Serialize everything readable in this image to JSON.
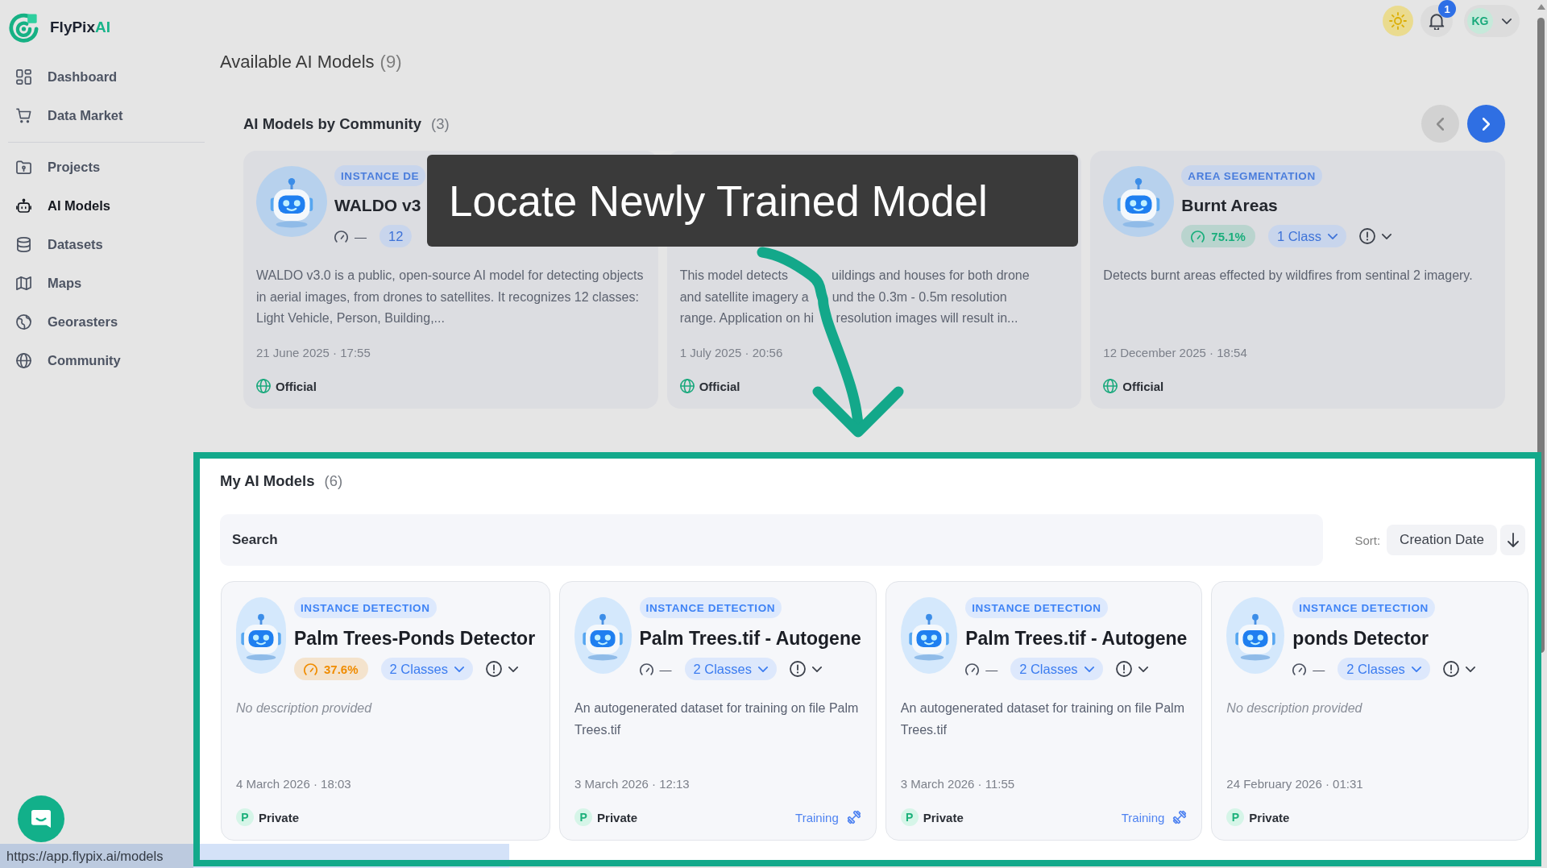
{
  "sidebar": {
    "brand": {
      "name": "FlyPix",
      "accent": "AI"
    },
    "sections": [
      {
        "items": [
          {
            "label": "Dashboard",
            "selected": false
          },
          {
            "label": "Data Market",
            "selected": false
          }
        ]
      },
      {
        "items": [
          {
            "label": "Projects",
            "selected": false
          },
          {
            "label": "AI Models",
            "selected": true
          },
          {
            "label": "Datasets",
            "selected": false
          },
          {
            "label": "Maps",
            "selected": false
          },
          {
            "label": "Georasters",
            "selected": false
          },
          {
            "label": "Community",
            "selected": false
          }
        ]
      }
    ]
  },
  "topbar": {
    "dark_mode": false,
    "notifications": {
      "count": "1"
    },
    "user": {
      "initials": "KG"
    }
  },
  "page": {
    "title": "Available AI Models",
    "count": "(9)"
  },
  "community": {
    "title": "AI Models by Community",
    "count": "(3)",
    "carousel": {
      "prev_enabled": false,
      "next_enabled": true
    },
    "cards": [
      {
        "avatar": true,
        "type": "INSTANCE DE",
        "name": "WALDO v3",
        "accuracy": {
          "text": "—"
        },
        "classes": {
          "text": "12",
          "caret": false
        },
        "info_button": false,
        "description": "WALDO v3.0 is a public, open-source AI model for detecting objects in aerial images, from drones to satellites. It recognizes 12 classes: Light Vehicle, Person, Building,...",
        "description_missing": false,
        "date": "21 June 2025 · 17:55",
        "visibility": {
          "kind": "official",
          "label": "Official"
        }
      },
      {
        "avatar": false,
        "info_button": false,
        "description_lines": [
          [
            "This model detects",
            "uildings and houses for both drone"
          ],
          [
            "and satellite imagery a",
            "und the 0.3m - 0.5m resolution"
          ],
          [
            "range. Application on hi",
            "resolution images will result in..."
          ]
        ],
        "description_missing": false,
        "date": "1 July 2025 · 20:56",
        "visibility": {
          "kind": "official",
          "label": "Official"
        }
      },
      {
        "avatar": true,
        "type": "AREA SEGMENTATION",
        "name": "Burnt Areas",
        "accuracy": {
          "text": "75.1%",
          "color": "#1aae7c"
        },
        "classes": {
          "text": "1 Class",
          "caret": true
        },
        "info_button": true,
        "description": "Detects burnt areas effected by wildfires from sentinal 2 imagery.",
        "description_missing": false,
        "date": "12 December 2025 · 18:54",
        "visibility": {
          "kind": "official",
          "label": "Official"
        }
      }
    ]
  },
  "annotation": {
    "callout": "Locate Newly Trained Model"
  },
  "my_models": {
    "title": "My AI Models",
    "count": "(6)",
    "search": {
      "placeholder": "Search"
    },
    "sort": {
      "label": "Sort:",
      "value": "Creation Date",
      "descending": true
    },
    "cards": [
      {
        "avatar": true,
        "type": "INSTANCE DETECTION",
        "name": "Palm Trees-Ponds Detector",
        "accuracy": {
          "text": "37.6%",
          "color": "#f08c00"
        },
        "classes": {
          "text": "2 Classes",
          "caret": true
        },
        "info_button": true,
        "description": "No description provided",
        "description_missing": true,
        "date": "4 March 2026 · 18:03",
        "visibility": {
          "kind": "private",
          "initial": "P",
          "label": "Private"
        }
      },
      {
        "avatar": true,
        "type": "INSTANCE DETECTION",
        "name": "Palm Trees.tif - Autogene",
        "accuracy": {
          "text": "—"
        },
        "classes": {
          "text": "2 Classes",
          "caret": true
        },
        "info_button": true,
        "description": "An autogenerated dataset for training on file Palm Trees.tif",
        "description_missing": false,
        "date": "3 March 2026 · 12:13",
        "visibility": {
          "kind": "private",
          "initial": "P",
          "label": "Private"
        },
        "status": {
          "label": "Training"
        }
      },
      {
        "avatar": true,
        "type": "INSTANCE DETECTION",
        "name": "Palm Trees.tif - Autogene",
        "accuracy": {
          "text": "—"
        },
        "classes": {
          "text": "2 Classes",
          "caret": true
        },
        "info_button": true,
        "description": "An autogenerated dataset for training on file Palm Trees.tif",
        "description_missing": false,
        "date": "3 March 2026 · 11:55",
        "visibility": {
          "kind": "private",
          "initial": "P",
          "label": "Private"
        },
        "status": {
          "label": "Training"
        }
      },
      {
        "avatar": true,
        "type": "INSTANCE DETECTION",
        "name": "ponds Detector",
        "accuracy": {
          "text": "—"
        },
        "classes": {
          "text": "2 Classes",
          "caret": true
        },
        "info_button": true,
        "description": "No description provided",
        "description_missing": true,
        "date": "24 February 2026 · 01:31",
        "visibility": {
          "kind": "private",
          "initial": "P",
          "label": "Private"
        }
      }
    ]
  },
  "status_bar": {
    "url": "https://app.flypix.ai/models"
  }
}
